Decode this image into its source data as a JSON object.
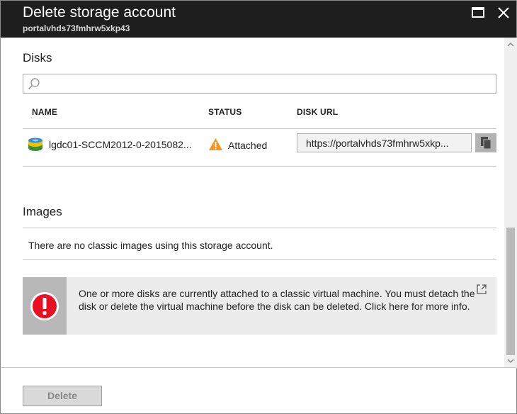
{
  "header": {
    "title": "Delete storage account",
    "subtitle": "portalvhds73fmhrw5xkp43"
  },
  "disks": {
    "section_title": "Disks",
    "search_placeholder": "",
    "columns": [
      "NAME",
      "STATUS",
      "DISK URL"
    ],
    "rows": [
      {
        "name": "lgdc01-SCCM2012-0-2015082...",
        "status": "Attached",
        "disk_url": "https://portalvhds73fmhrw5xkp..."
      }
    ]
  },
  "images": {
    "section_title": "Images",
    "empty_message": "There are no classic images using this storage account."
  },
  "alert": {
    "message": "One or more disks are currently attached to a classic virtual machine. You must detach the disk or delete the virtual machine before the disk can be deleted. Click here for more info."
  },
  "footer": {
    "delete_label": "Delete"
  },
  "colors": {
    "header_bg": "#1e1e1e",
    "alert_red": "#e81123",
    "warning_orange": "#f7941d"
  },
  "icons": [
    "maximize-icon",
    "close-icon",
    "search-icon",
    "disk-icon",
    "warning-icon",
    "copy-icon",
    "error-icon",
    "external-link-icon"
  ]
}
